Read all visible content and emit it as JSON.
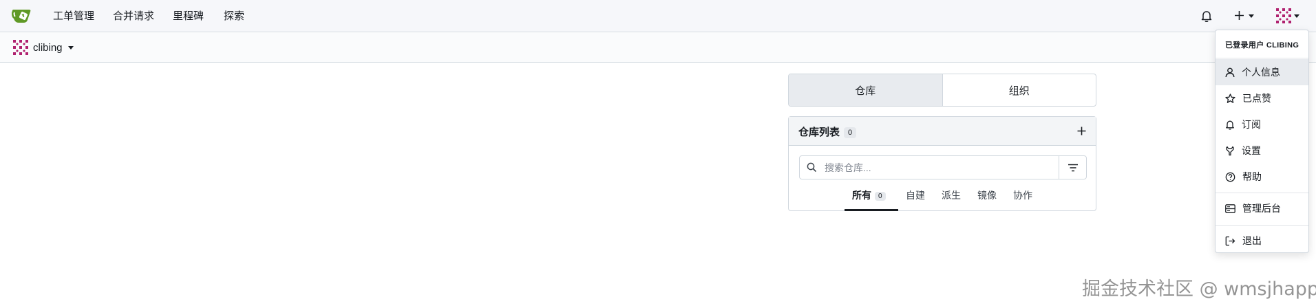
{
  "topnav": {
    "items": [
      "工单管理",
      "合并请求",
      "里程碑",
      "探索"
    ],
    "icons": [
      "bell-icon",
      "plus-icon",
      "avatar"
    ]
  },
  "context": {
    "username": "clibing"
  },
  "tabs": {
    "repos": "仓库",
    "orgs": "组织"
  },
  "repo_list": {
    "title": "仓库列表",
    "count": "0",
    "search_placeholder": "搜索仓库...",
    "filters": [
      {
        "label": "所有",
        "count": "0"
      },
      {
        "label": "自建"
      },
      {
        "label": "派生"
      },
      {
        "label": "镜像"
      },
      {
        "label": "协作"
      }
    ]
  },
  "user_menu": {
    "header": "已登录用户 CLIBING",
    "items": [
      "个人信息",
      "已点赞",
      "订阅",
      "设置",
      "帮助",
      "管理后台",
      "退出"
    ]
  },
  "watermark": "掘金技术社区 @ wmsjhappy",
  "colors": {
    "accent": "#609926",
    "avatar": "#b0216f",
    "border": "#d0d7de"
  }
}
